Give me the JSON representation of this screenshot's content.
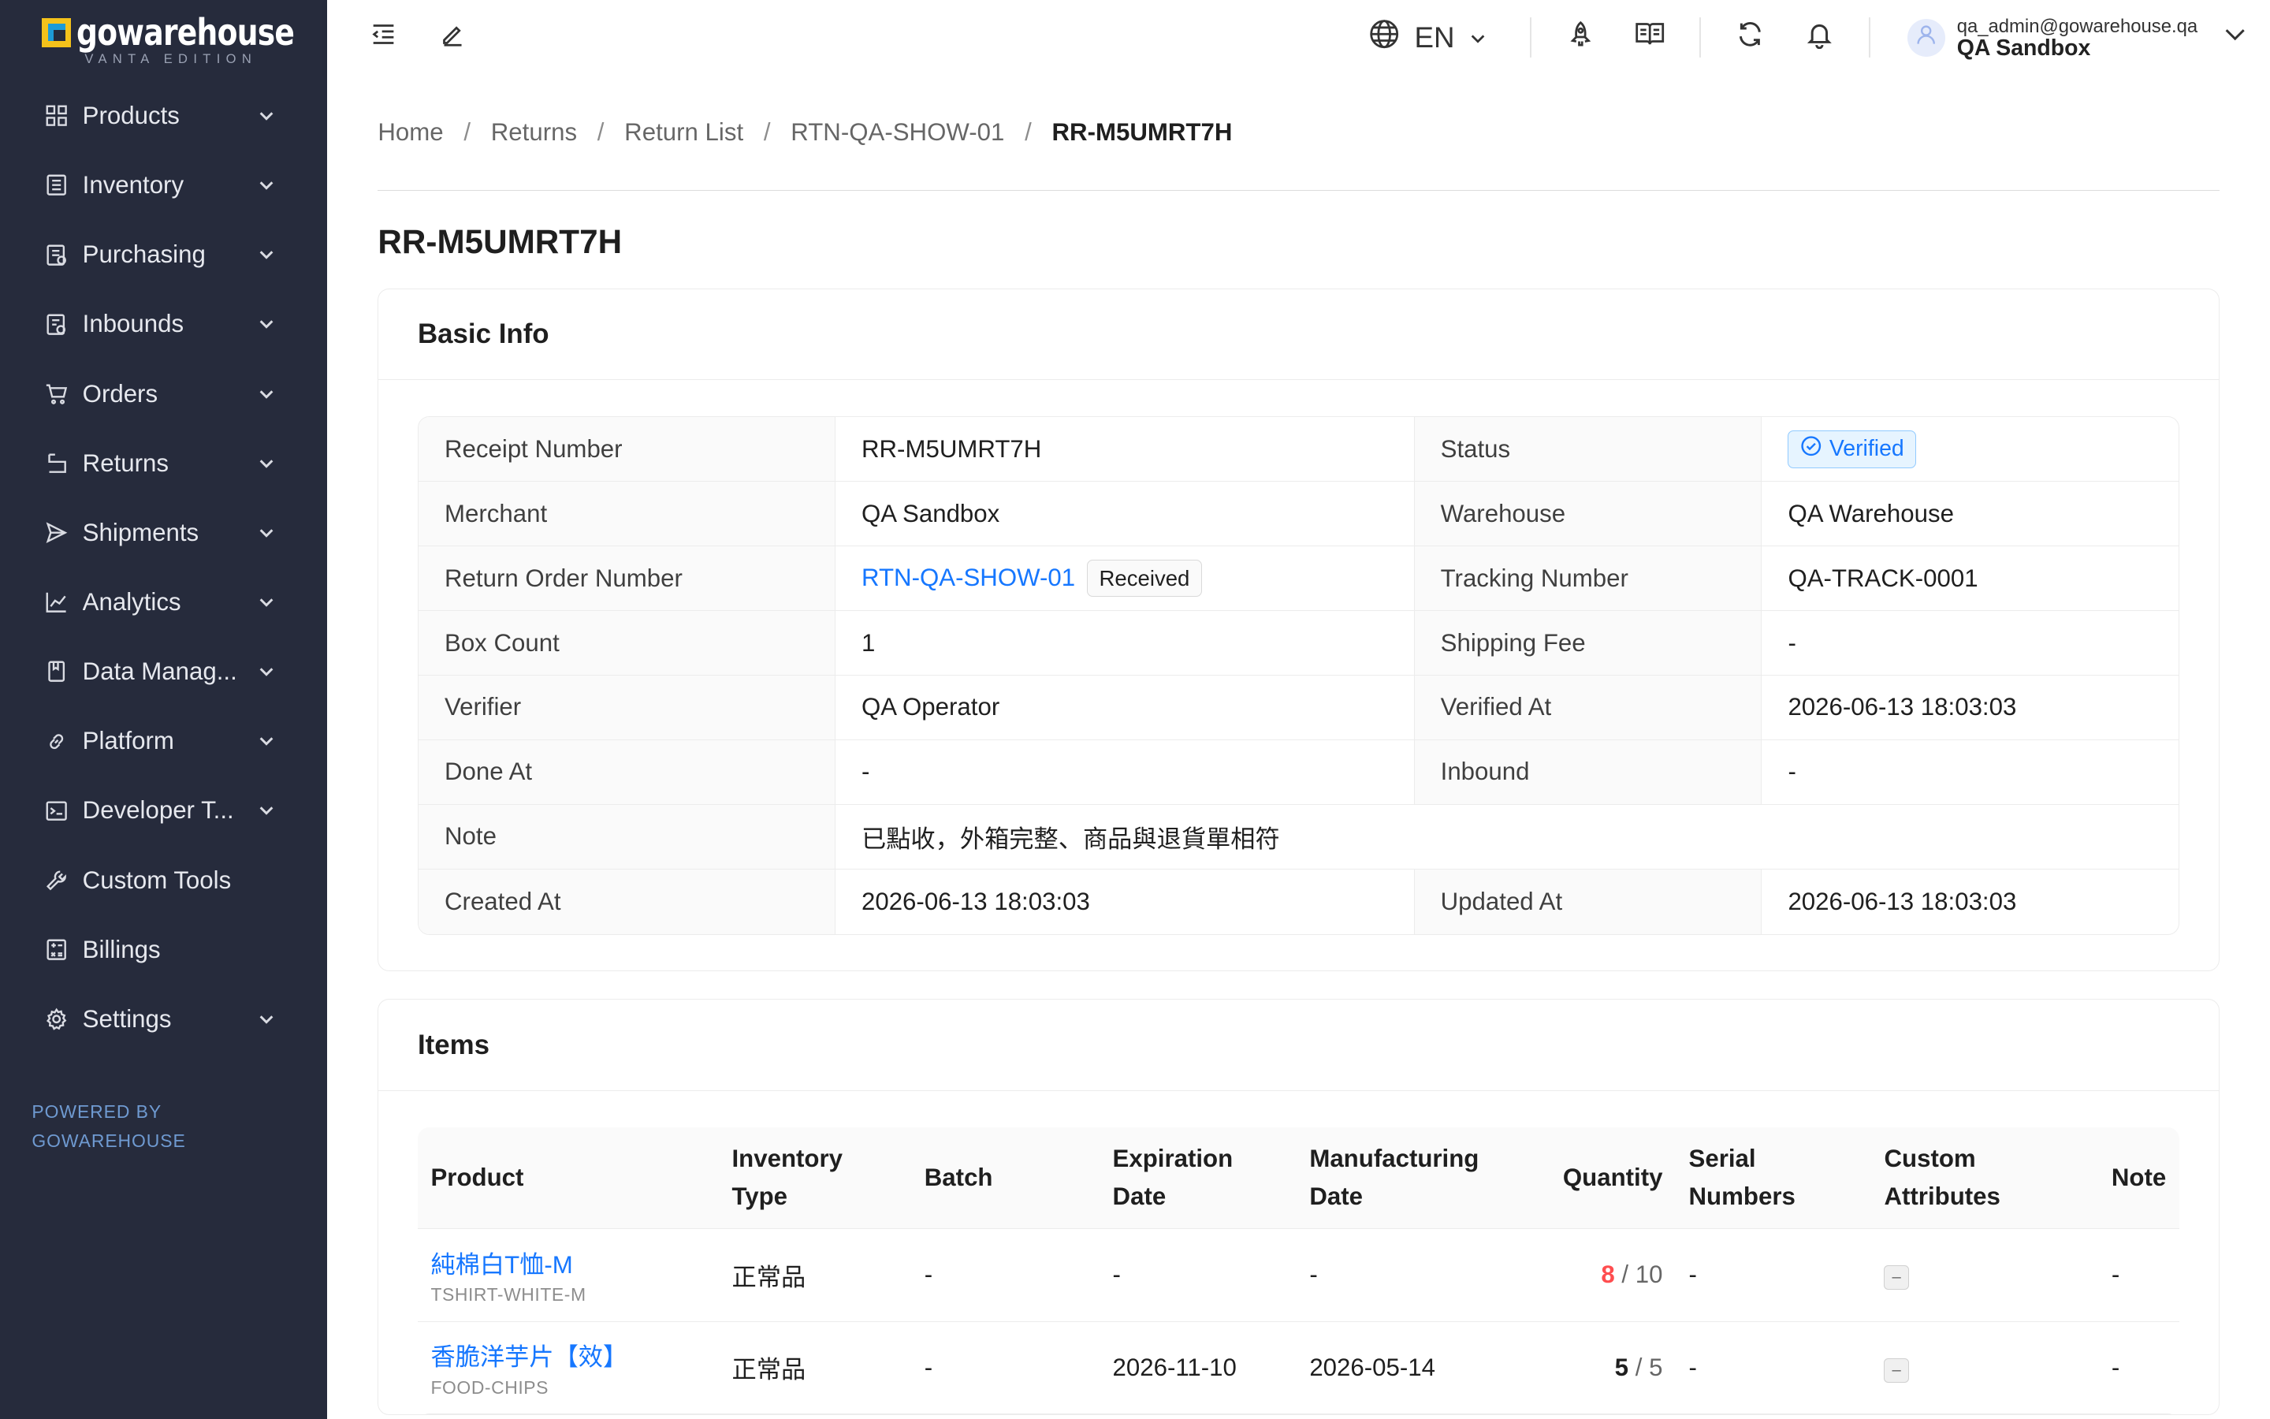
{
  "app": {
    "logo_text": "gowarehouse",
    "logo_subtitle": "VANTA EDITION",
    "powered_by_line1": "POWERED BY",
    "powered_by_line2": "GOWAREHOUSE"
  },
  "sidebar": {
    "items": [
      {
        "label": "Products",
        "icon": "grid-icon",
        "has_children": true
      },
      {
        "label": "Inventory",
        "icon": "box-list-icon",
        "has_children": true
      },
      {
        "label": "Purchasing",
        "icon": "clipboard-icon",
        "has_children": true
      },
      {
        "label": "Inbounds",
        "icon": "inbound-doc-icon",
        "has_children": true
      },
      {
        "label": "Orders",
        "icon": "cart-icon",
        "has_children": true
      },
      {
        "label": "Returns",
        "icon": "return-icon",
        "has_children": true
      },
      {
        "label": "Shipments",
        "icon": "send-icon",
        "has_children": true
      },
      {
        "label": "Analytics",
        "icon": "line-chart-icon",
        "has_children": true
      },
      {
        "label": "Data Manag...",
        "icon": "book-icon",
        "has_children": true
      },
      {
        "label": "Platform",
        "icon": "link-icon",
        "has_children": true
      },
      {
        "label": "Developer T...",
        "icon": "terminal-icon",
        "has_children": true
      },
      {
        "label": "Custom Tools",
        "icon": "wrench-icon",
        "has_children": false
      },
      {
        "label": "Billings",
        "icon": "calculator-icon",
        "has_children": false
      },
      {
        "label": "Settings",
        "icon": "gear-icon",
        "has_children": true
      }
    ]
  },
  "header": {
    "language": "EN",
    "user_email": "qa_admin@gowarehouse.qa",
    "user_org": "QA Sandbox"
  },
  "breadcrumb": {
    "items": [
      "Home",
      "Returns",
      "Return List",
      "RTN-QA-SHOW-01"
    ],
    "current": "RR-M5UMRT7H"
  },
  "page": {
    "title": "RR-M5UMRT7H"
  },
  "basic_info": {
    "title": "Basic Info",
    "receipt_number_label": "Receipt Number",
    "receipt_number": "RR-M5UMRT7H",
    "status_label": "Status",
    "status": "Verified",
    "merchant_label": "Merchant",
    "merchant": "QA Sandbox",
    "warehouse_label": "Warehouse",
    "warehouse": "QA Warehouse",
    "return_order_number_label": "Return Order Number",
    "return_order_number": "RTN-QA-SHOW-01",
    "return_order_status": "Received",
    "tracking_number_label": "Tracking Number",
    "tracking_number": "QA-TRACK-0001",
    "box_count_label": "Box Count",
    "box_count": "1",
    "shipping_fee_label": "Shipping Fee",
    "shipping_fee": "-",
    "verifier_label": "Verifier",
    "verifier": "QA Operator",
    "verified_at_label": "Verified At",
    "verified_at": "2026-06-13 18:03:03",
    "done_at_label": "Done At",
    "done_at": "-",
    "inbound_label": "Inbound",
    "inbound": "-",
    "note_label": "Note",
    "note": "已點收，外箱完整、商品與退貨單相符",
    "created_at_label": "Created At",
    "created_at": "2026-06-13 18:03:03",
    "updated_at_label": "Updated At",
    "updated_at": "2026-06-13 18:03:03"
  },
  "items": {
    "title": "Items",
    "columns": {
      "product": "Product",
      "inventory_type_1": "Inventory",
      "inventory_type_2": "Type",
      "batch": "Batch",
      "expiration_1": "Expiration",
      "expiration_2": "Date",
      "manufacturing_1": "Manufacturing",
      "manufacturing_2": "Date",
      "quantity": "Quantity",
      "serial_1": "Serial",
      "serial_2": "Numbers",
      "custom_1": "Custom",
      "custom_2": "Attributes",
      "note": "Note"
    },
    "rows": [
      {
        "product_name": "純棉白T恤-M",
        "sku": "TSHIRT-WHITE-M",
        "inventory_type": "正常品",
        "batch": "-",
        "expiration_date": "-",
        "manufacturing_date": "-",
        "qty_received": "8",
        "qty_sep": "/",
        "qty_total": "10",
        "serial_numbers": "-",
        "custom_attributes": "–",
        "note": "-"
      },
      {
        "product_name": "香脆洋芋片【效】",
        "sku": "FOOD-CHIPS",
        "inventory_type": "正常品",
        "batch": "-",
        "expiration_date": "2026-11-10",
        "manufacturing_date": "2026-05-14",
        "qty_received": "5",
        "qty_sep": "/",
        "qty_total": "5",
        "serial_numbers": "-",
        "custom_attributes": "–",
        "note": "-"
      }
    ]
  },
  "colors": {
    "sidebar_bg": "#262b3c",
    "accent": "#1677ff",
    "danger": "#ff4d4f"
  }
}
